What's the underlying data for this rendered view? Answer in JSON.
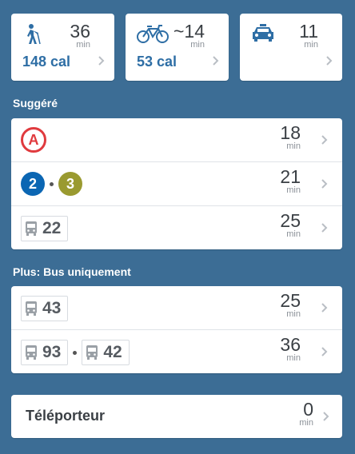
{
  "modes": [
    {
      "icon": "walk-icon",
      "time": "36",
      "unit": "min",
      "calories": "148 cal"
    },
    {
      "icon": "bike-icon",
      "time": "~14",
      "unit": "min",
      "calories": "53 cal"
    },
    {
      "icon": "taxi-icon",
      "time": "11",
      "unit": "min",
      "calories": ""
    }
  ],
  "suggested": {
    "label": "Suggéré",
    "routes": [
      {
        "line": "A",
        "time": "18",
        "unit": "min"
      },
      {
        "lines": [
          "2",
          "3"
        ],
        "time": "21",
        "unit": "min"
      },
      {
        "bus": "22",
        "time": "25",
        "unit": "min"
      }
    ]
  },
  "bus_only": {
    "label": "Plus: Bus uniquement",
    "routes": [
      {
        "bus": "43",
        "time": "25",
        "unit": "min"
      },
      {
        "buses": [
          "93",
          "42"
        ],
        "time": "36",
        "unit": "min"
      }
    ]
  },
  "teleporter": {
    "label": "Téléporteur",
    "time": "0",
    "unit": "min"
  },
  "colors": {
    "background": "#3c6d95",
    "line_A": "#e03a3e",
    "line_2": "#0b66b3",
    "line_3": "#9a9a30",
    "calories": "#2e6ea5"
  }
}
